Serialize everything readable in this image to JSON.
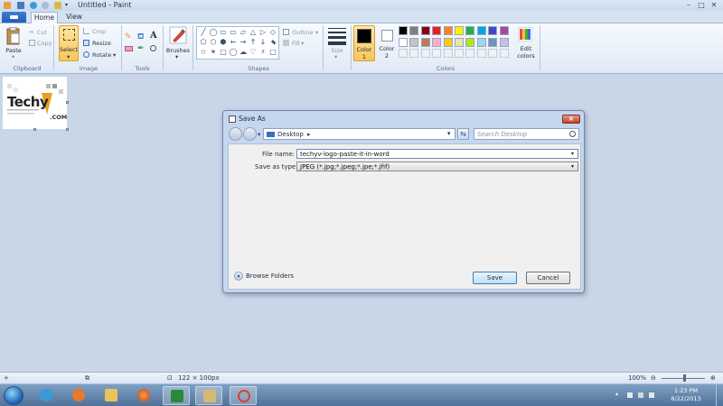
{
  "window": {
    "title": "Untitled - Paint"
  },
  "tabs": {
    "file_icon": "file-menu-icon",
    "home": "Home",
    "view": "View"
  },
  "ribbon": {
    "clipboard": {
      "paste": "Paste",
      "cut": "Cut",
      "copy": "Copy",
      "label": "Clipboard"
    },
    "image": {
      "select": "Select",
      "crop": "Crop",
      "resize": "Resize",
      "rotate": "Rotate",
      "label": "Image"
    },
    "tools": {
      "label": "Tools"
    },
    "brushes": {
      "label": "Brushes"
    },
    "shapes": {
      "outline": "Outline",
      "fill": "Fill",
      "label": "Shapes",
      "glyphs": [
        "╱",
        "◯",
        "▭",
        "▭",
        "▱",
        "△",
        "▷",
        "◇",
        "⬠",
        "⬡",
        "⬢",
        "←",
        "→",
        "↑",
        "↓",
        "✦",
        "☆",
        "✶",
        "▢",
        "◯",
        "☁",
        "♡",
        "⚡",
        "▢"
      ]
    },
    "size": {
      "label": "Size"
    },
    "colors": {
      "color1": "Color",
      "color1_num": "1",
      "color2": "Color",
      "color2_num": "2",
      "edit": "Edit",
      "edit2": "colors",
      "label": "Colors",
      "color1_value": "#000000",
      "color2_value": "#ffffff",
      "palette_row1": [
        "#000000",
        "#7f7f7f",
        "#880015",
        "#ed1c24",
        "#ff7f27",
        "#fff200",
        "#22b14c",
        "#00a2e8",
        "#3f48cc",
        "#a349a4"
      ],
      "palette_row2": [
        "#ffffff",
        "#c3c3c3",
        "#b97a57",
        "#ffaec9",
        "#ffc90e",
        "#efe4b0",
        "#b5e61d",
        "#99d9ea",
        "#7092be",
        "#c8bfe7"
      ]
    }
  },
  "canvas": {
    "logo_text": "Techy",
    "logo_suffix": ".COM"
  },
  "dialog": {
    "title": "Save As",
    "address": "Desktop",
    "search_placeholder": "Search Desktop",
    "file_name_label": "File name:",
    "file_name_value": "techyv-logo-paste-it-in-word",
    "save_as_type_label": "Save as type:",
    "save_as_type_value": "JPEG (*.jpg;*.jpeg;*.jpe;*.jfif)",
    "browse_folders": "Browse Folders",
    "save": "Save",
    "cancel": "Cancel"
  },
  "status": {
    "dimensions": "122 × 100px",
    "zoom": "100%"
  },
  "taskbar": {
    "time": "1:23 PM",
    "date": "8/22/2013"
  }
}
